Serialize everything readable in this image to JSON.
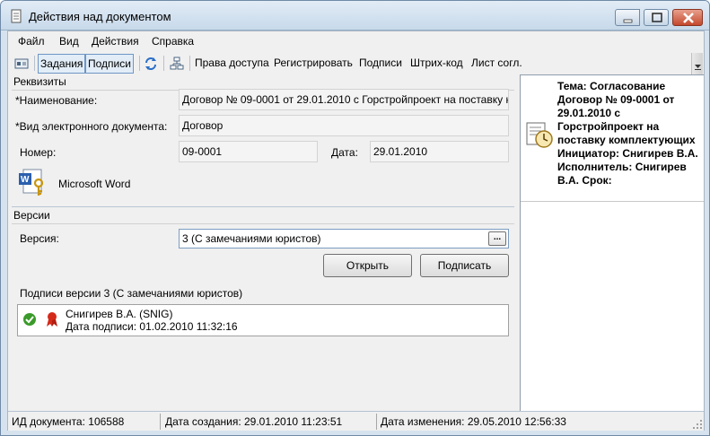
{
  "window": {
    "title": "Действия над документом"
  },
  "menu": {
    "items": [
      "Файл",
      "Вид",
      "Действия",
      "Справка"
    ]
  },
  "toolbar": {
    "tasks_label": "Задания",
    "signatures_toggle_label": "Подписи",
    "access_rights_label": "Права доступа",
    "register_label": "Регистрировать",
    "signatures_label": "Подписи",
    "barcode_label": "Штрих-код",
    "approval_sheet_label": "Лист согл."
  },
  "requisites": {
    "section_title": "Реквизиты",
    "name_label": "*Наименование:",
    "name_value": "Договор № 09-0001 от 29.01.2010 с Горстройпроект на поставку комплектующих",
    "doctype_label": "*Вид электронного документа:",
    "doctype_value": "Договор",
    "number_label": "Номер:",
    "number_value": "09-0001",
    "date_label": "Дата:",
    "date_value": "29.01.2010",
    "file_label": "Microsoft Word"
  },
  "versions": {
    "section_title": "Версии",
    "version_label": "Версия:",
    "version_value": "3 (С замечаниями юристов)",
    "browse_label": "...",
    "open_button": "Открыть",
    "sign_button": "Подписать",
    "signatures_title": "Подписи версии 3 (С замечаниями юристов)",
    "signatures": [
      {
        "signer": "Снигирев В.А. (SNIG)",
        "date": "Дата подписи: 01.02.2010 11:32:16"
      }
    ]
  },
  "task_panel": {
    "text": "Тема: Согласование Договор № 09-0001 от 29.01.2010 с Горстройпроект на поставку комплектующих Инициатор: Снигирев В.А. Исполнитель: Снигирев В.А. Срок:"
  },
  "statusbar": {
    "doc_id": "ИД документа: 106588",
    "created": "Дата создания: 29.01.2010 11:23:51",
    "modified": "Дата изменения: 29.05.2010 12:56:33"
  },
  "colors": {
    "title_gradient_top": "#e2ecf6",
    "close_button": "#c4482d",
    "check_green": "#3a9a2a",
    "seal_red": "#d42a1a"
  }
}
